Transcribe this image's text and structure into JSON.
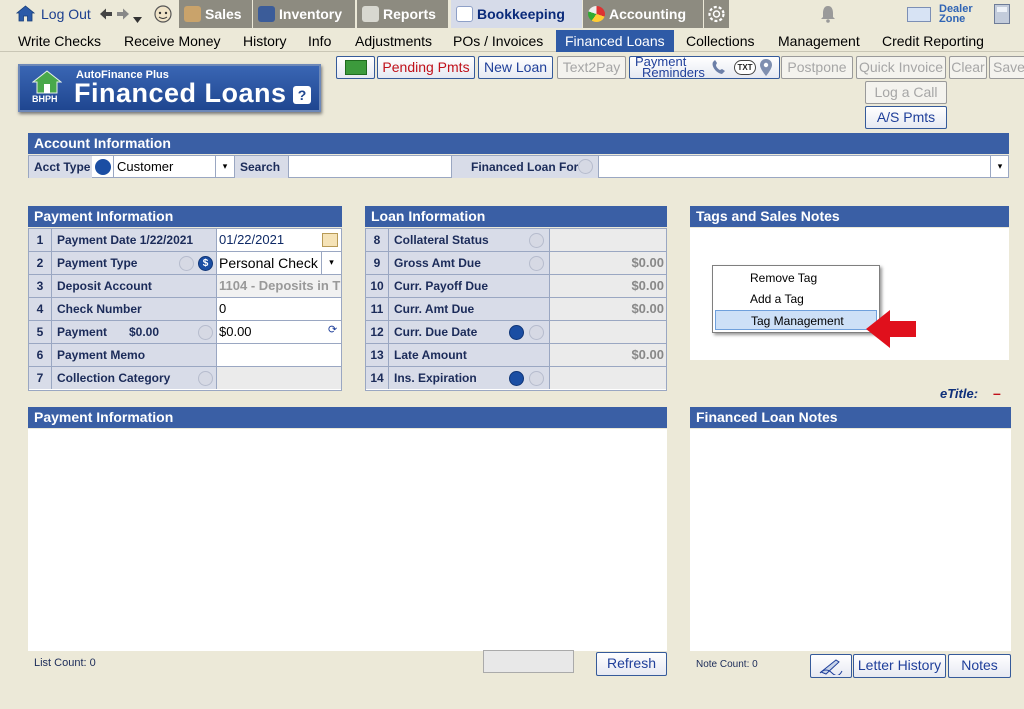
{
  "topbar": {
    "logout_label": "Log Out",
    "nav_items": [
      {
        "label": "Sales"
      },
      {
        "label": "Inventory"
      },
      {
        "label": "Reports"
      },
      {
        "label": "Bookkeeping"
      },
      {
        "label": "Accounting"
      }
    ],
    "dealer_zone_line1": "Dealer",
    "dealer_zone_line2": "Zone"
  },
  "menu": {
    "items": [
      "Write Checks",
      "Receive Money",
      "History",
      "Info",
      "Adjustments",
      "POs / Invoices",
      "Financed Loans",
      "Collections",
      "Management",
      "Credit Reporting"
    ],
    "active": "Financed Loans"
  },
  "toolbar": {
    "pending_pmts": "Pending Pmts",
    "new_loan": "New Loan",
    "text2pay": "Text2Pay",
    "payment_reminders_line1": "Payment",
    "payment_reminders_line2": "Reminders",
    "txt_badge": "TXT",
    "postpone": "Postpone",
    "quick_invoice": "Quick Invoice",
    "clear": "Clear",
    "save": "Save",
    "log_a_call": "Log a Call",
    "as_pmts": "A/S Pmts"
  },
  "logo": {
    "subtitle": "AutoFinance Plus",
    "title": "Financed Loans",
    "badge": "BHPH",
    "help": "?"
  },
  "account": {
    "header": "Account Information",
    "acct_type_label": "Acct Type",
    "acct_type_value": "Customer",
    "search_label": "Search",
    "search_value": "",
    "financed_for_label": "Financed Loan For",
    "financed_for_value": ""
  },
  "payment_info": {
    "header": "Payment Information",
    "rows": [
      {
        "num": "1",
        "label": "Payment Date  1/22/2021",
        "value": "01/22/2021"
      },
      {
        "num": "2",
        "label": "Payment Type",
        "value": "Personal Check"
      },
      {
        "num": "3",
        "label": "Deposit Account",
        "value": "1104 - Deposits in T"
      },
      {
        "num": "4",
        "label": "Check Number",
        "value": "0"
      },
      {
        "num": "5",
        "label": "Payment",
        "label_amount": "$0.00",
        "value": "$0.00"
      },
      {
        "num": "6",
        "label": "Payment Memo",
        "value": ""
      },
      {
        "num": "7",
        "label": "Collection Category",
        "value": ""
      }
    ]
  },
  "loan_info": {
    "header": "Loan Information",
    "rows": [
      {
        "num": "8",
        "label": "Collateral Status",
        "value": ""
      },
      {
        "num": "9",
        "label": "Gross Amt Due",
        "value": "$0.00"
      },
      {
        "num": "10",
        "label": "Curr. Payoff Due",
        "value": "$0.00"
      },
      {
        "num": "11",
        "label": "Curr. Amt Due",
        "value": "$0.00"
      },
      {
        "num": "12",
        "label": "Curr. Due Date",
        "value": ""
      },
      {
        "num": "13",
        "label": "Late Amount",
        "value": "$0.00"
      },
      {
        "num": "14",
        "label": "Ins. Expiration",
        "value": ""
      }
    ]
  },
  "tags": {
    "header": "Tags and Sales Notes",
    "context_menu": [
      "Remove Tag",
      "Add a Tag",
      "Tag Management"
    ],
    "selected": "Tag Management"
  },
  "etitle": {
    "label": "eTitle:",
    "value": "–"
  },
  "payment_list": {
    "header": "Payment Information",
    "list_count": "List Count: 0",
    "refresh": "Refresh"
  },
  "loan_notes": {
    "header": "Financed Loan Notes",
    "note_count": "Note Count: 0",
    "letter_history": "Letter History",
    "notes": "Notes"
  },
  "colors": {
    "header_blue": "#3a5fa5",
    "active_menu": "#2e5aa6",
    "link_blue": "#1f3f9a",
    "alert_red": "#e0101c"
  }
}
